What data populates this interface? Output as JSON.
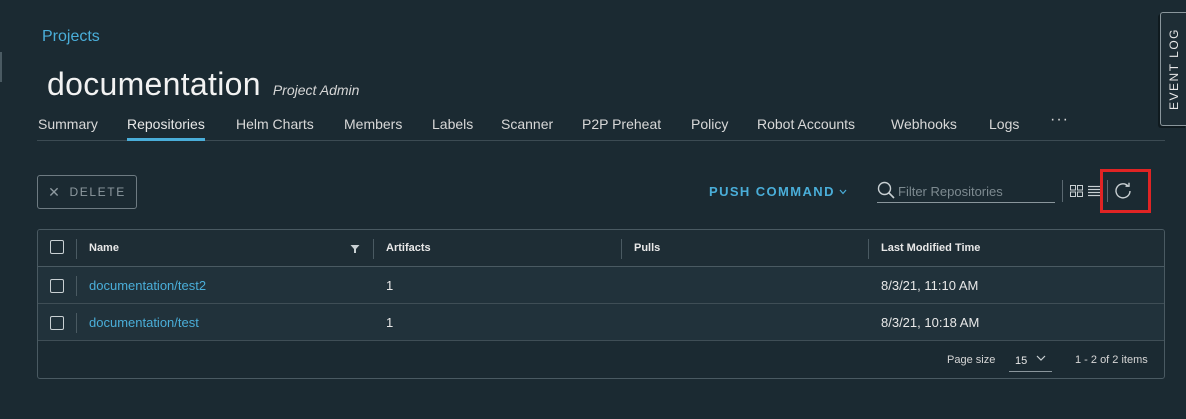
{
  "breadcrumb": {
    "label": "Projects"
  },
  "header": {
    "title": "documentation",
    "role": "Project Admin"
  },
  "tabs": [
    {
      "label": "Summary"
    },
    {
      "label": "Repositories",
      "active": true
    },
    {
      "label": "Helm Charts"
    },
    {
      "label": "Members"
    },
    {
      "label": "Labels"
    },
    {
      "label": "Scanner"
    },
    {
      "label": "P2P Preheat"
    },
    {
      "label": "Policy"
    },
    {
      "label": "Robot Accounts"
    },
    {
      "label": "Webhooks"
    },
    {
      "label": "Logs"
    }
  ],
  "tabs_more_label": "···",
  "event_log": {
    "label": "EVENT LOG"
  },
  "toolbar": {
    "delete_label": "DELETE",
    "delete_icon": "close-icon",
    "push_command_label": "PUSH COMMAND",
    "filter_placeholder": "Filter Repositories",
    "filter_value": "",
    "view_icon": "grid-list-toggle-icon",
    "refresh_icon": "refresh-icon"
  },
  "table": {
    "columns": [
      "Name",
      "Artifacts",
      "Pulls",
      "Last Modified Time"
    ],
    "rows": [
      {
        "name": "documentation/test2",
        "artifacts": "1",
        "pulls": "",
        "modified": "8/3/21, 11:10 AM"
      },
      {
        "name": "documentation/test",
        "artifacts": "1",
        "pulls": "",
        "modified": "8/3/21, 10:18 AM"
      }
    ],
    "footer": {
      "page_size_label": "Page size",
      "page_size_value": "15",
      "item_count": "1 - 2 of 2 items"
    }
  },
  "colors": {
    "background": "#1b2a32",
    "accent": "#4aaed9",
    "highlight": "#e02424"
  }
}
